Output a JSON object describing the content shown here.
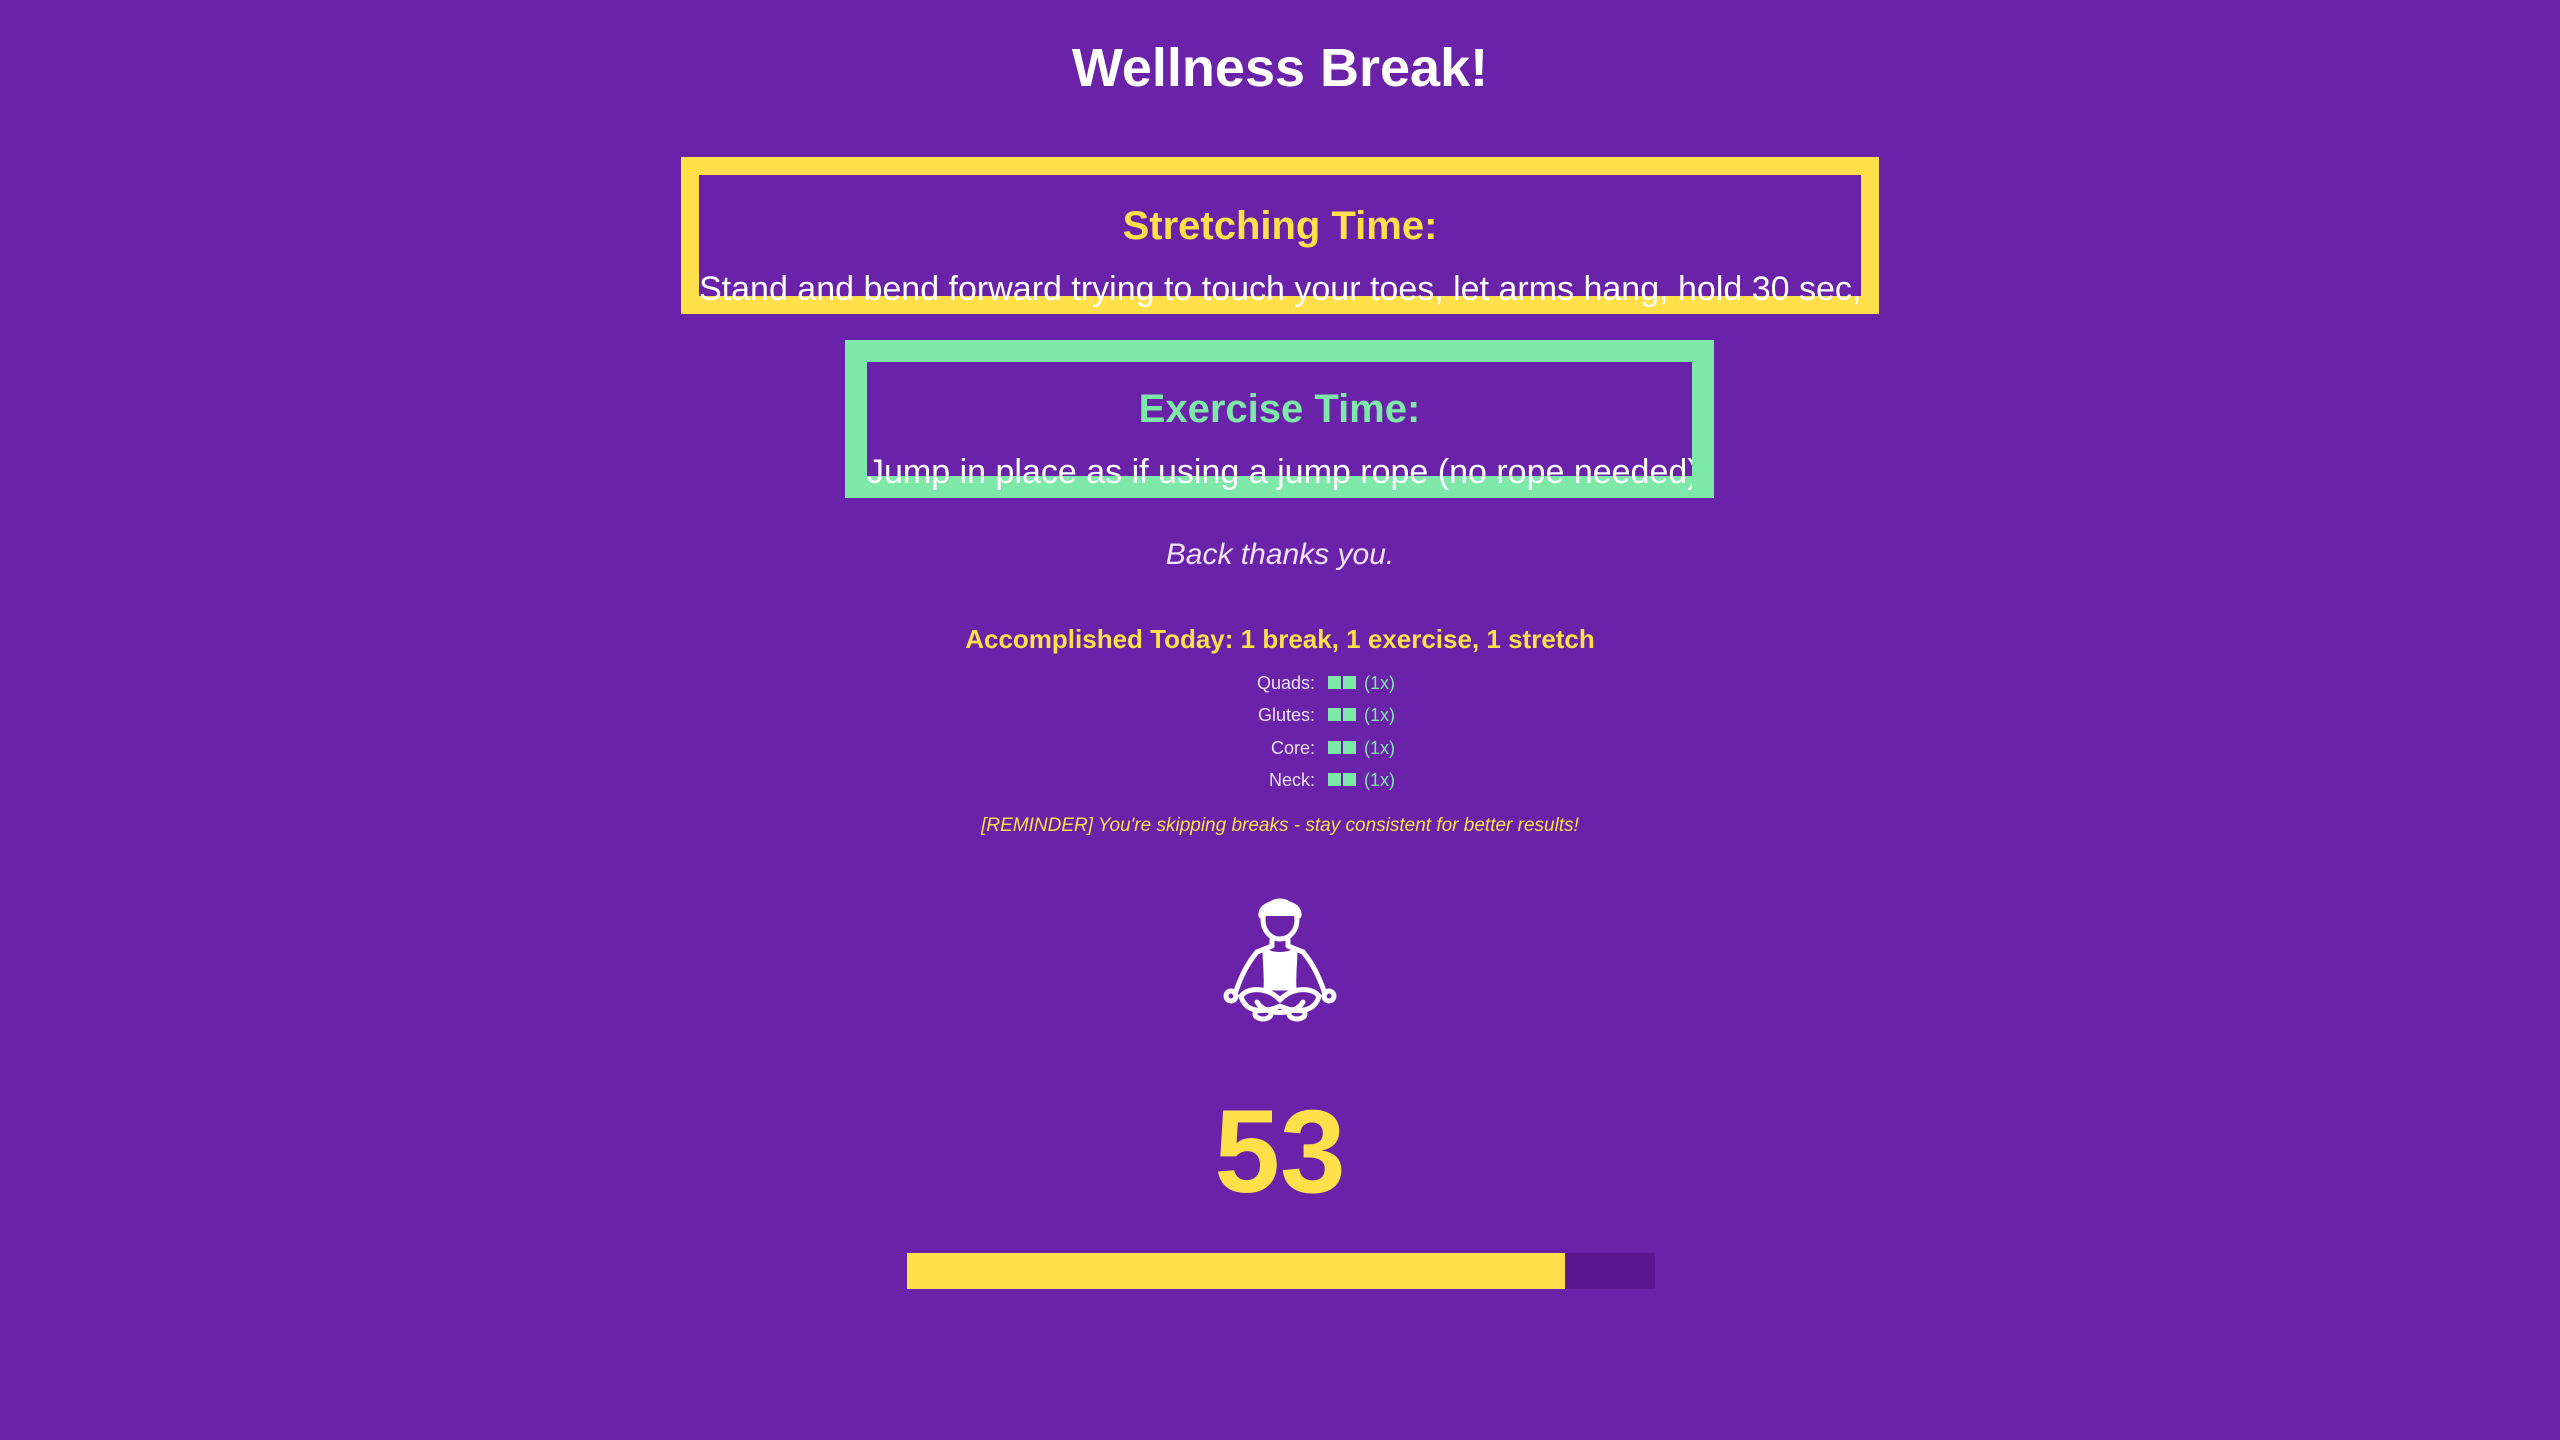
{
  "title": "Wellness Break!",
  "stretch": {
    "heading": "Stretching Time:",
    "text": "Stand and bend forward trying to touch your toes, let arms hang, hold 30 sec,"
  },
  "exercise": {
    "heading": "Exercise Time:",
    "text": "Jump in place as if using a jump rope (no rope needed)"
  },
  "motivation": "Back thanks you.",
  "accomplished": "Accomplished Today: 1 break, 1 exercise, 1 stretch",
  "muscles": [
    {
      "label": "Quads:",
      "count": "(1x)"
    },
    {
      "label": "Glutes:",
      "count": "(1x)"
    },
    {
      "label": "Core:",
      "count": "(1x)"
    },
    {
      "label": "Neck:",
      "count": "(1x)"
    }
  ],
  "reminder": "[REMINDER] You're skipping breaks - stay consistent for better results!",
  "figure_icon": "meditation-figure-icon",
  "countdown": "53",
  "progress_fraction": 0.88,
  "colors": {
    "background": "#6a22a8",
    "stretch_accent": "#ffdf4a",
    "exercise_accent": "#7de8a8",
    "text": "#ffffff",
    "progress_track": "#5a1890"
  }
}
